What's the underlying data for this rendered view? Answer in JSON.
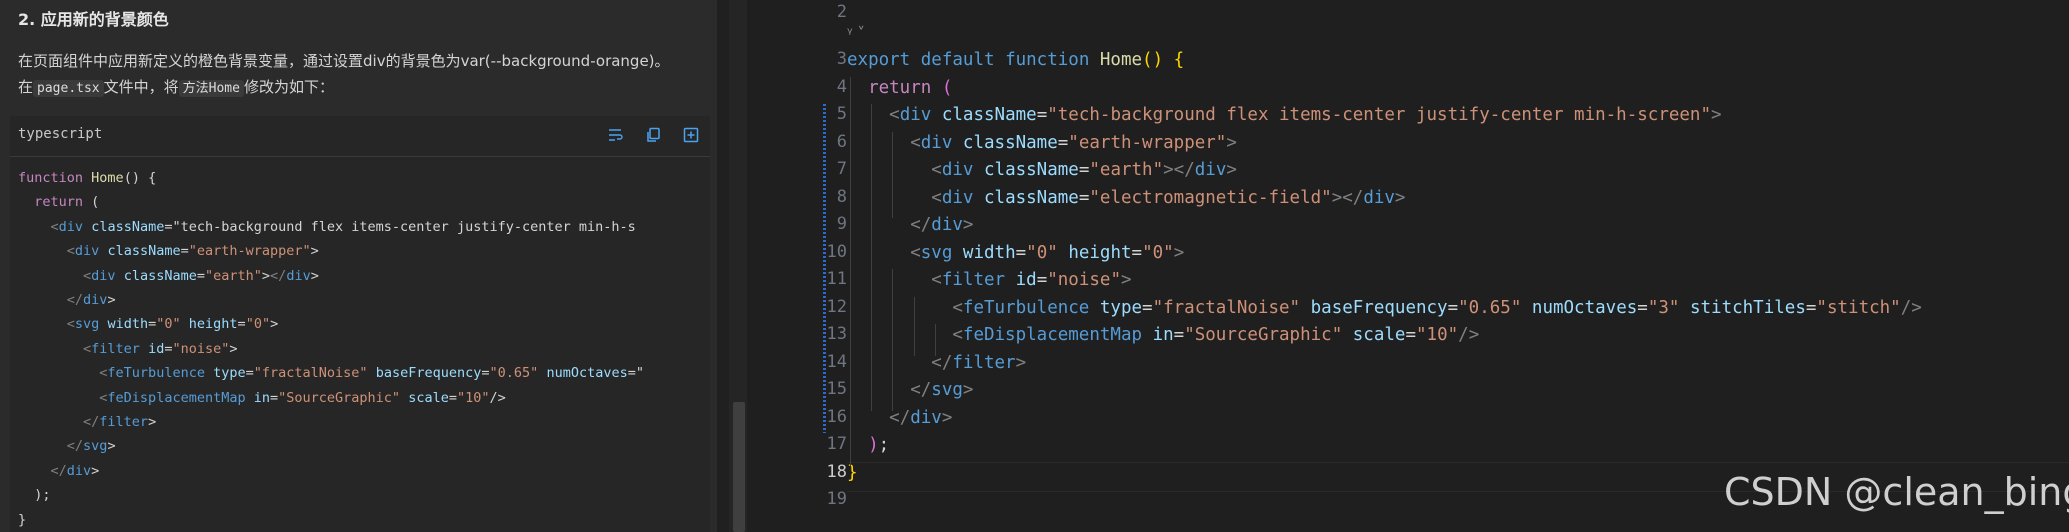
{
  "doc": {
    "heading": "2. 应用新的背景颜色",
    "p1": "在页面组件中应用新定义的橙色背景变量，通过设置div的背景色为var(--background-orange)。",
    "p2_a": "在",
    "p2_code1": "page.tsx",
    "p2_b": "文件中，将",
    "p2_code2": "方法Home",
    "p2_c": "修改为如下：",
    "code_lang": "typescript",
    "icons": [
      "wrap-icon",
      "copy-icon",
      "insert-icon"
    ],
    "snippet": [
      "function Home() {",
      "  return (",
      "    <div className=\"tech-background flex items-center justify-center min-h-s",
      "      <div className=\"earth-wrapper\">",
      "        <div className=\"earth\"></div>",
      "      </div>",
      "      <svg width=\"0\" height=\"0\">",
      "        <filter id=\"noise\">",
      "          <feTurbulence type=\"fractalNoise\" baseFrequency=\"0.65\" numOctaves=\"",
      "          <feDisplacementMap in=\"SourceGraphic\" scale=\"10\"/>",
      "        </filter>",
      "      </svg>",
      "    </div>",
      "  );",
      "}"
    ]
  },
  "editor": {
    "line_numbers": [
      "2",
      "3",
      "4",
      "5",
      "6",
      "7",
      "8",
      "9",
      "10",
      "11",
      "12",
      "13",
      "14",
      "15",
      "16",
      "17",
      "18",
      "19"
    ],
    "current_line": "18",
    "codelens_glyph": "ᵞ",
    "codelens_chevron": "˅",
    "lines": [
      [],
      [
        [
          "kw",
          "export "
        ],
        [
          "kw",
          "default "
        ],
        [
          "kw",
          "function "
        ],
        [
          "fn",
          "Home"
        ],
        [
          "br1",
          "()"
        ],
        [
          "",
          " "
        ],
        [
          "br1",
          "{"
        ]
      ],
      [
        [
          "",
          "  "
        ],
        [
          "kc",
          "return "
        ],
        [
          "br2",
          "("
        ]
      ],
      [
        [
          "",
          "    "
        ],
        [
          "ang",
          "<"
        ],
        [
          "tag",
          "div "
        ],
        [
          "attr",
          "className"
        ],
        [
          "",
          "="
        ],
        [
          "str",
          "\"tech-background flex items-center justify-center min-h-screen\""
        ],
        [
          "ang",
          ">"
        ]
      ],
      [
        [
          "",
          "      "
        ],
        [
          "ang",
          "<"
        ],
        [
          "tag",
          "div "
        ],
        [
          "attr",
          "className"
        ],
        [
          "",
          "="
        ],
        [
          "str",
          "\"earth-wrapper\""
        ],
        [
          "ang",
          ">"
        ]
      ],
      [
        [
          "",
          "        "
        ],
        [
          "ang",
          "<"
        ],
        [
          "tag",
          "div "
        ],
        [
          "attr",
          "className"
        ],
        [
          "",
          "="
        ],
        [
          "str",
          "\"earth\""
        ],
        [
          "ang",
          "></"
        ],
        [
          "tag",
          "div"
        ],
        [
          "ang",
          ">"
        ]
      ],
      [
        [
          "",
          "        "
        ],
        [
          "ang",
          "<"
        ],
        [
          "tag",
          "div "
        ],
        [
          "attr",
          "className"
        ],
        [
          "",
          "="
        ],
        [
          "str",
          "\"electromagnetic-field\""
        ],
        [
          "ang",
          "></"
        ],
        [
          "tag",
          "div"
        ],
        [
          "ang",
          ">"
        ]
      ],
      [
        [
          "",
          "      "
        ],
        [
          "ang",
          "</"
        ],
        [
          "tag",
          "div"
        ],
        [
          "ang",
          ">"
        ]
      ],
      [
        [
          "",
          "      "
        ],
        [
          "ang",
          "<"
        ],
        [
          "tag",
          "svg "
        ],
        [
          "attr",
          "width"
        ],
        [
          "",
          "="
        ],
        [
          "str",
          "\"0\" "
        ],
        [
          "attr",
          "height"
        ],
        [
          "",
          "="
        ],
        [
          "str",
          "\"0\""
        ],
        [
          "ang",
          ">"
        ]
      ],
      [
        [
          "",
          "        "
        ],
        [
          "ang",
          "<"
        ],
        [
          "tag",
          "filter "
        ],
        [
          "attr",
          "id"
        ],
        [
          "",
          "="
        ],
        [
          "str",
          "\"noise\""
        ],
        [
          "ang",
          ">"
        ]
      ],
      [
        [
          "",
          "          "
        ],
        [
          "ang",
          "<"
        ],
        [
          "tag",
          "feTurbulence "
        ],
        [
          "attr",
          "type"
        ],
        [
          "",
          "="
        ],
        [
          "str",
          "\"fractalNoise\" "
        ],
        [
          "attr",
          "baseFrequency"
        ],
        [
          "",
          "="
        ],
        [
          "str",
          "\"0.65\" "
        ],
        [
          "attr",
          "numOctaves"
        ],
        [
          "",
          "="
        ],
        [
          "str",
          "\"3\" "
        ],
        [
          "attr",
          "stitchTiles"
        ],
        [
          "",
          "="
        ],
        [
          "str",
          "\"stitch\""
        ],
        [
          "ang",
          "/>"
        ]
      ],
      [
        [
          "",
          "          "
        ],
        [
          "ang",
          "<"
        ],
        [
          "tag",
          "feDisplacementMap "
        ],
        [
          "attr",
          "in"
        ],
        [
          "",
          "="
        ],
        [
          "str",
          "\"SourceGraphic\" "
        ],
        [
          "attr",
          "scale"
        ],
        [
          "",
          "="
        ],
        [
          "str",
          "\"10\""
        ],
        [
          "ang",
          "/>"
        ]
      ],
      [
        [
          "",
          "        "
        ],
        [
          "ang",
          "</"
        ],
        [
          "tag",
          "filter"
        ],
        [
          "ang",
          ">"
        ]
      ],
      [
        [
          "",
          "      "
        ],
        [
          "ang",
          "</"
        ],
        [
          "tag",
          "svg"
        ],
        [
          "ang",
          ">"
        ]
      ],
      [
        [
          "",
          "    "
        ],
        [
          "ang",
          "</"
        ],
        [
          "tag",
          "div"
        ],
        [
          "ang",
          ">"
        ]
      ],
      [
        [
          "",
          "  "
        ],
        [
          "br2",
          ")"
        ],
        [
          "",
          ";"
        ]
      ],
      [
        [
          "br1",
          "}"
        ]
      ],
      []
    ]
  },
  "watermark": "CSDN @clean_bing"
}
